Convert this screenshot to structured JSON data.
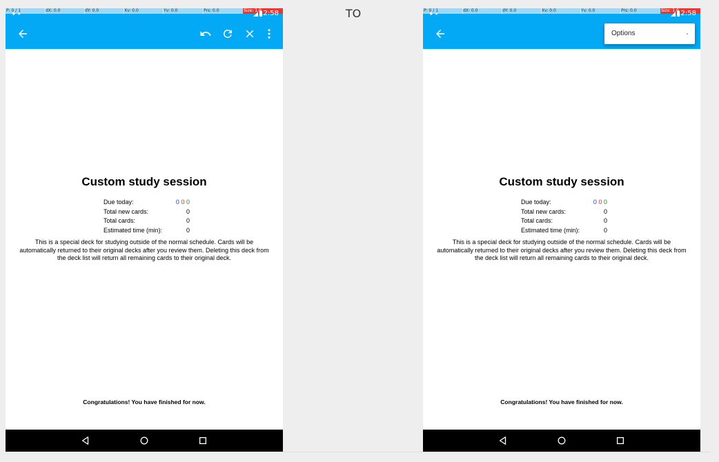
{
  "transition_label": "TO",
  "pointer_overlay": {
    "p": "P: 0 / 1",
    "dx": "dX: 0.0",
    "dy": "dY: 0.0",
    "xv": "Xv: 0.0",
    "yv": "Yv: 0.0",
    "prs": "Prs: 0.0",
    "size": "Size: 1.0"
  },
  "status_bar": {
    "time": "12:58"
  },
  "toolbar": {
    "back_icon": "arrow-left-icon",
    "undo_icon": "undo-icon",
    "rebuild_icon": "refresh-icon",
    "empty_icon": "close-icon",
    "more_icon": "more-vert-icon"
  },
  "overflow_menu": {
    "items": [
      {
        "label": "Options"
      }
    ]
  },
  "deck": {
    "title": "Custom study session",
    "stats": {
      "due_today_label": "Due today:",
      "due_new": "0",
      "due_learn": "0",
      "due_review": "0",
      "total_new_label": "Total new cards:",
      "total_new_value": "0",
      "total_cards_label": "Total cards:",
      "total_cards_value": "0",
      "est_time_label": "Estimated time (min):",
      "est_time_value": "0"
    },
    "description": "This is a special deck for studying outside of the normal schedule. Cards will be automatically returned to their original decks after you review them. Deleting this deck from the deck list will return all remaining cards to their original deck.",
    "congrats": "Congratulations! You have finished for now."
  },
  "colors": {
    "primary": "#03a9f4",
    "due_new": "#1e3fd6",
    "due_learn": "#d32f2f",
    "due_review": "#2e7d32",
    "nav_bar": "#000000",
    "pointer_size_cell": "#e53935"
  },
  "nav_bar": {
    "back_icon": "nav-back-icon",
    "home_icon": "nav-home-icon",
    "recents_icon": "nav-recents-icon"
  }
}
